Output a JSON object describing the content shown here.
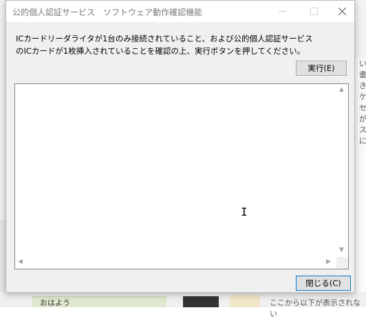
{
  "window": {
    "title": "公的個人認証サービス　ソフトウェア動作確認機能"
  },
  "message": {
    "line1": "ICカードリーダライタが1台のみ接続されていること、および公的個人認証サービス",
    "line2": "のICカードが1枚挿入されていることを確認の上、実行ボタンを押してください。"
  },
  "buttons": {
    "execute_label": "実行(E)",
    "close_label": "閉じる(C)"
  },
  "output": {
    "text": ""
  },
  "background": {
    "right_glyphs": [
      "い",
      "書",
      "き",
      "ケ",
      "セ",
      "が",
      "ス",
      "に"
    ],
    "bottom_green_text": "おはよう",
    "bottom_text": "ここから以下が表示されない"
  },
  "icons": {
    "minimize": "minimize-icon",
    "maximize": "maximize-icon",
    "close": "close-icon",
    "cursor": "text-cursor-icon"
  },
  "colors": {
    "dialog_bg": "#f0f0f0",
    "focus_border": "#0078d7"
  }
}
